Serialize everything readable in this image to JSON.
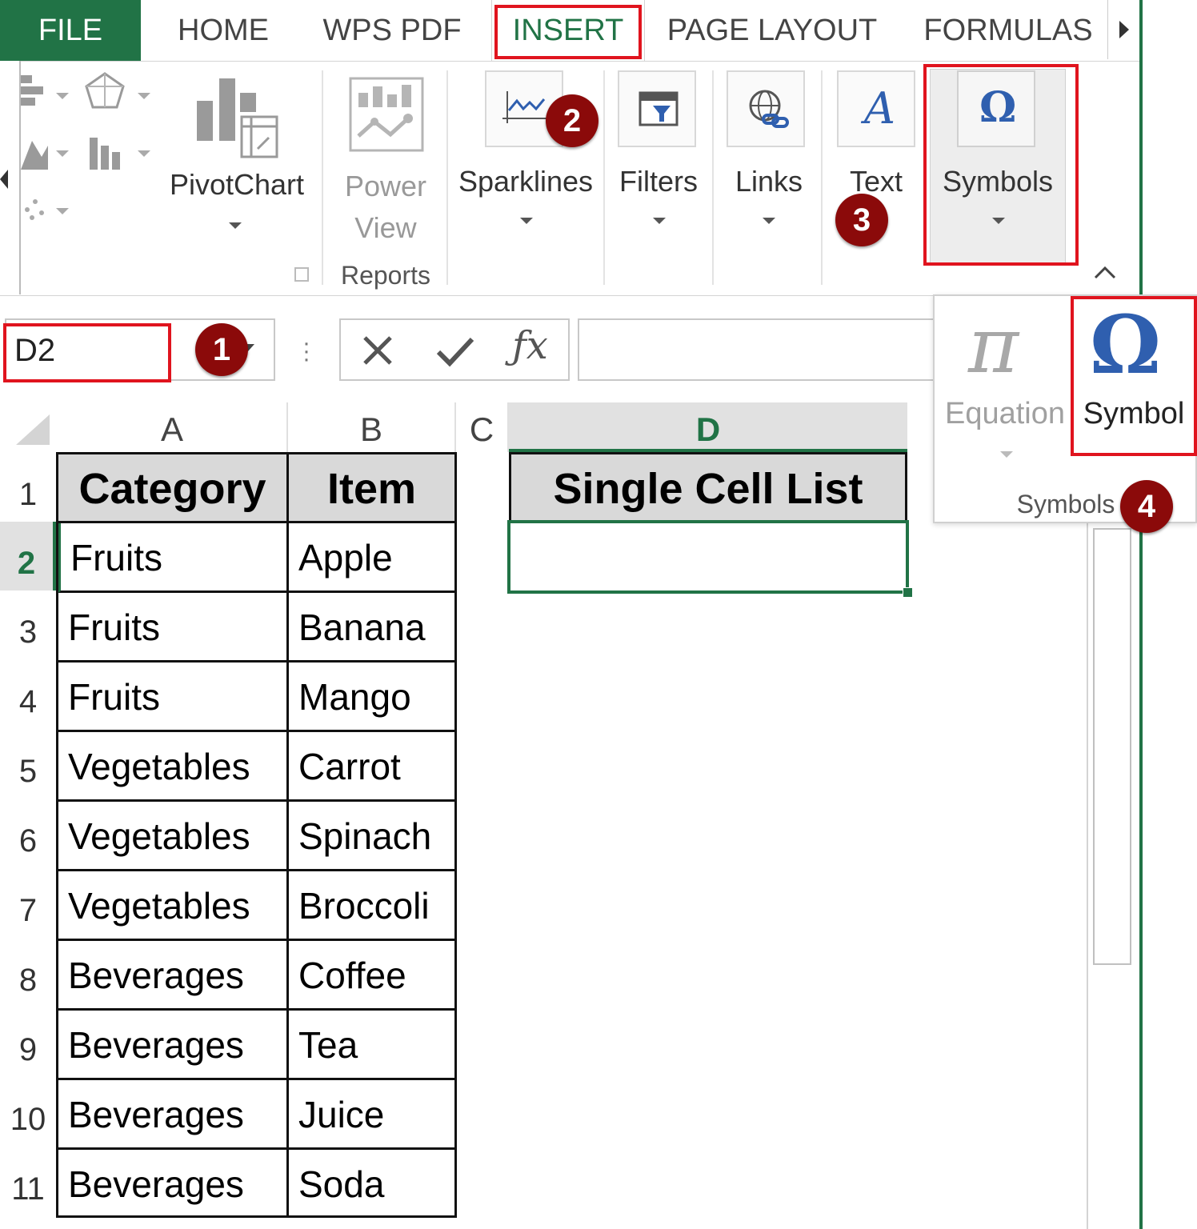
{
  "tabs": {
    "file": "FILE",
    "home": "HOME",
    "wps_pdf": "WPS PDF",
    "insert": "INSERT",
    "page_layout": "PAGE LAYOUT",
    "formulas": "FORMULAS"
  },
  "ribbon": {
    "pivotchart": "PivotChart",
    "power_view_line1": "Power",
    "power_view_line2": "View",
    "reports_group": "Reports",
    "sparklines": "Sparklines",
    "filters": "Filters",
    "links": "Links",
    "text": "Text",
    "symbols": "Symbols"
  },
  "symbols_panel": {
    "equation": "Equation",
    "symbol": "Symbol",
    "group_label": "Symbols"
  },
  "formula_bar": {
    "name_box": "D2",
    "formula_value": ""
  },
  "steps": [
    "1",
    "2",
    "3",
    "4"
  ],
  "columns": [
    "A",
    "B",
    "C",
    "D"
  ],
  "row_numbers": [
    "1",
    "2",
    "3",
    "4",
    "5",
    "6",
    "7",
    "8",
    "9",
    "10",
    "11"
  ],
  "table": {
    "headers": [
      "Category",
      "Item"
    ],
    "rows": [
      [
        "Fruits",
        "Apple"
      ],
      [
        "Fruits",
        "Banana"
      ],
      [
        "Fruits",
        "Mango"
      ],
      [
        "Vegetables",
        "Carrot"
      ],
      [
        "Vegetables",
        "Spinach"
      ],
      [
        "Vegetables",
        "Broccoli"
      ],
      [
        "Beverages",
        "Coffee"
      ],
      [
        "Beverages",
        "Tea"
      ],
      [
        "Beverages",
        "Juice"
      ],
      [
        "Beverages",
        "Soda"
      ]
    ]
  },
  "single_list": {
    "header": "Single Cell List",
    "value": ""
  },
  "colors": {
    "file_tab": "#217346",
    "active_tab_text": "#217346",
    "highlight_red": "#e0141e",
    "badge": "#8b0a0a",
    "selection_green": "#217346",
    "symbol_blue": "#2f5faf"
  }
}
